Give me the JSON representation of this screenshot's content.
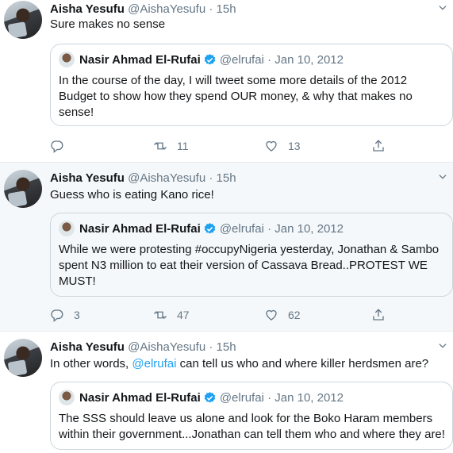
{
  "tweets": [
    {
      "author": {
        "name": "Aisha Yesufu",
        "handle": "@AishaYesufu",
        "separator": "·",
        "time": "15h"
      },
      "text_before": "Sure makes no sense",
      "mention": "",
      "text_after": "",
      "quote": {
        "name": "Nasir Ahmad El-Rufai",
        "handle": "@elrufai",
        "separator": "·",
        "date": "Jan 10, 2012",
        "lines": [
          "In the course of the day, I will tweet some more details of the 2012",
          "Budget to show how they spend OUR money, & why that makes no",
          "sense!"
        ]
      },
      "actions": {
        "replies": "",
        "retweets": "11",
        "likes": "13"
      }
    },
    {
      "author": {
        "name": "Aisha Yesufu",
        "handle": "@AishaYesufu",
        "separator": "·",
        "time": "15h"
      },
      "text_before": "Guess who is eating Kano rice!",
      "mention": "",
      "text_after": "",
      "quote": {
        "name": "Nasir Ahmad El-Rufai",
        "handle": "@elrufai",
        "separator": "·",
        "date": "Jan 10, 2012",
        "lines": [
          "While we were protesting #occupyNigeria yesterday, Jonathan & Sambo",
          "spent N3 million to eat their version of Cassava Bread..PROTEST WE",
          "MUST!"
        ]
      },
      "actions": {
        "replies": "3",
        "retweets": "47",
        "likes": "62"
      }
    },
    {
      "author": {
        "name": "Aisha Yesufu",
        "handle": "@AishaYesufu",
        "separator": "·",
        "time": "15h"
      },
      "text_before": "In other words, ",
      "mention": "@elrufai",
      "text_after": " can tell us who and where killer herdsmen are?",
      "quote": {
        "name": "Nasir Ahmad El-Rufai",
        "handle": "@elrufai",
        "separator": "·",
        "date": "Jan 10, 2012",
        "lines": [
          "The SSS should leave us alone and look for the Boko Haram members",
          "within their government...Jonathan can tell them who and where they are!"
        ]
      },
      "actions": {
        "replies": "",
        "retweets": "",
        "likes": ""
      }
    }
  ],
  "colors": {
    "accent": "#1da1f2",
    "muted": "#657786",
    "border": "#ccd6dd",
    "highlight_bg": "#f5f8fa"
  },
  "icons": [
    "reply-icon",
    "retweet-icon",
    "like-icon",
    "share-icon",
    "verified-badge-icon",
    "chevron-down-icon"
  ]
}
